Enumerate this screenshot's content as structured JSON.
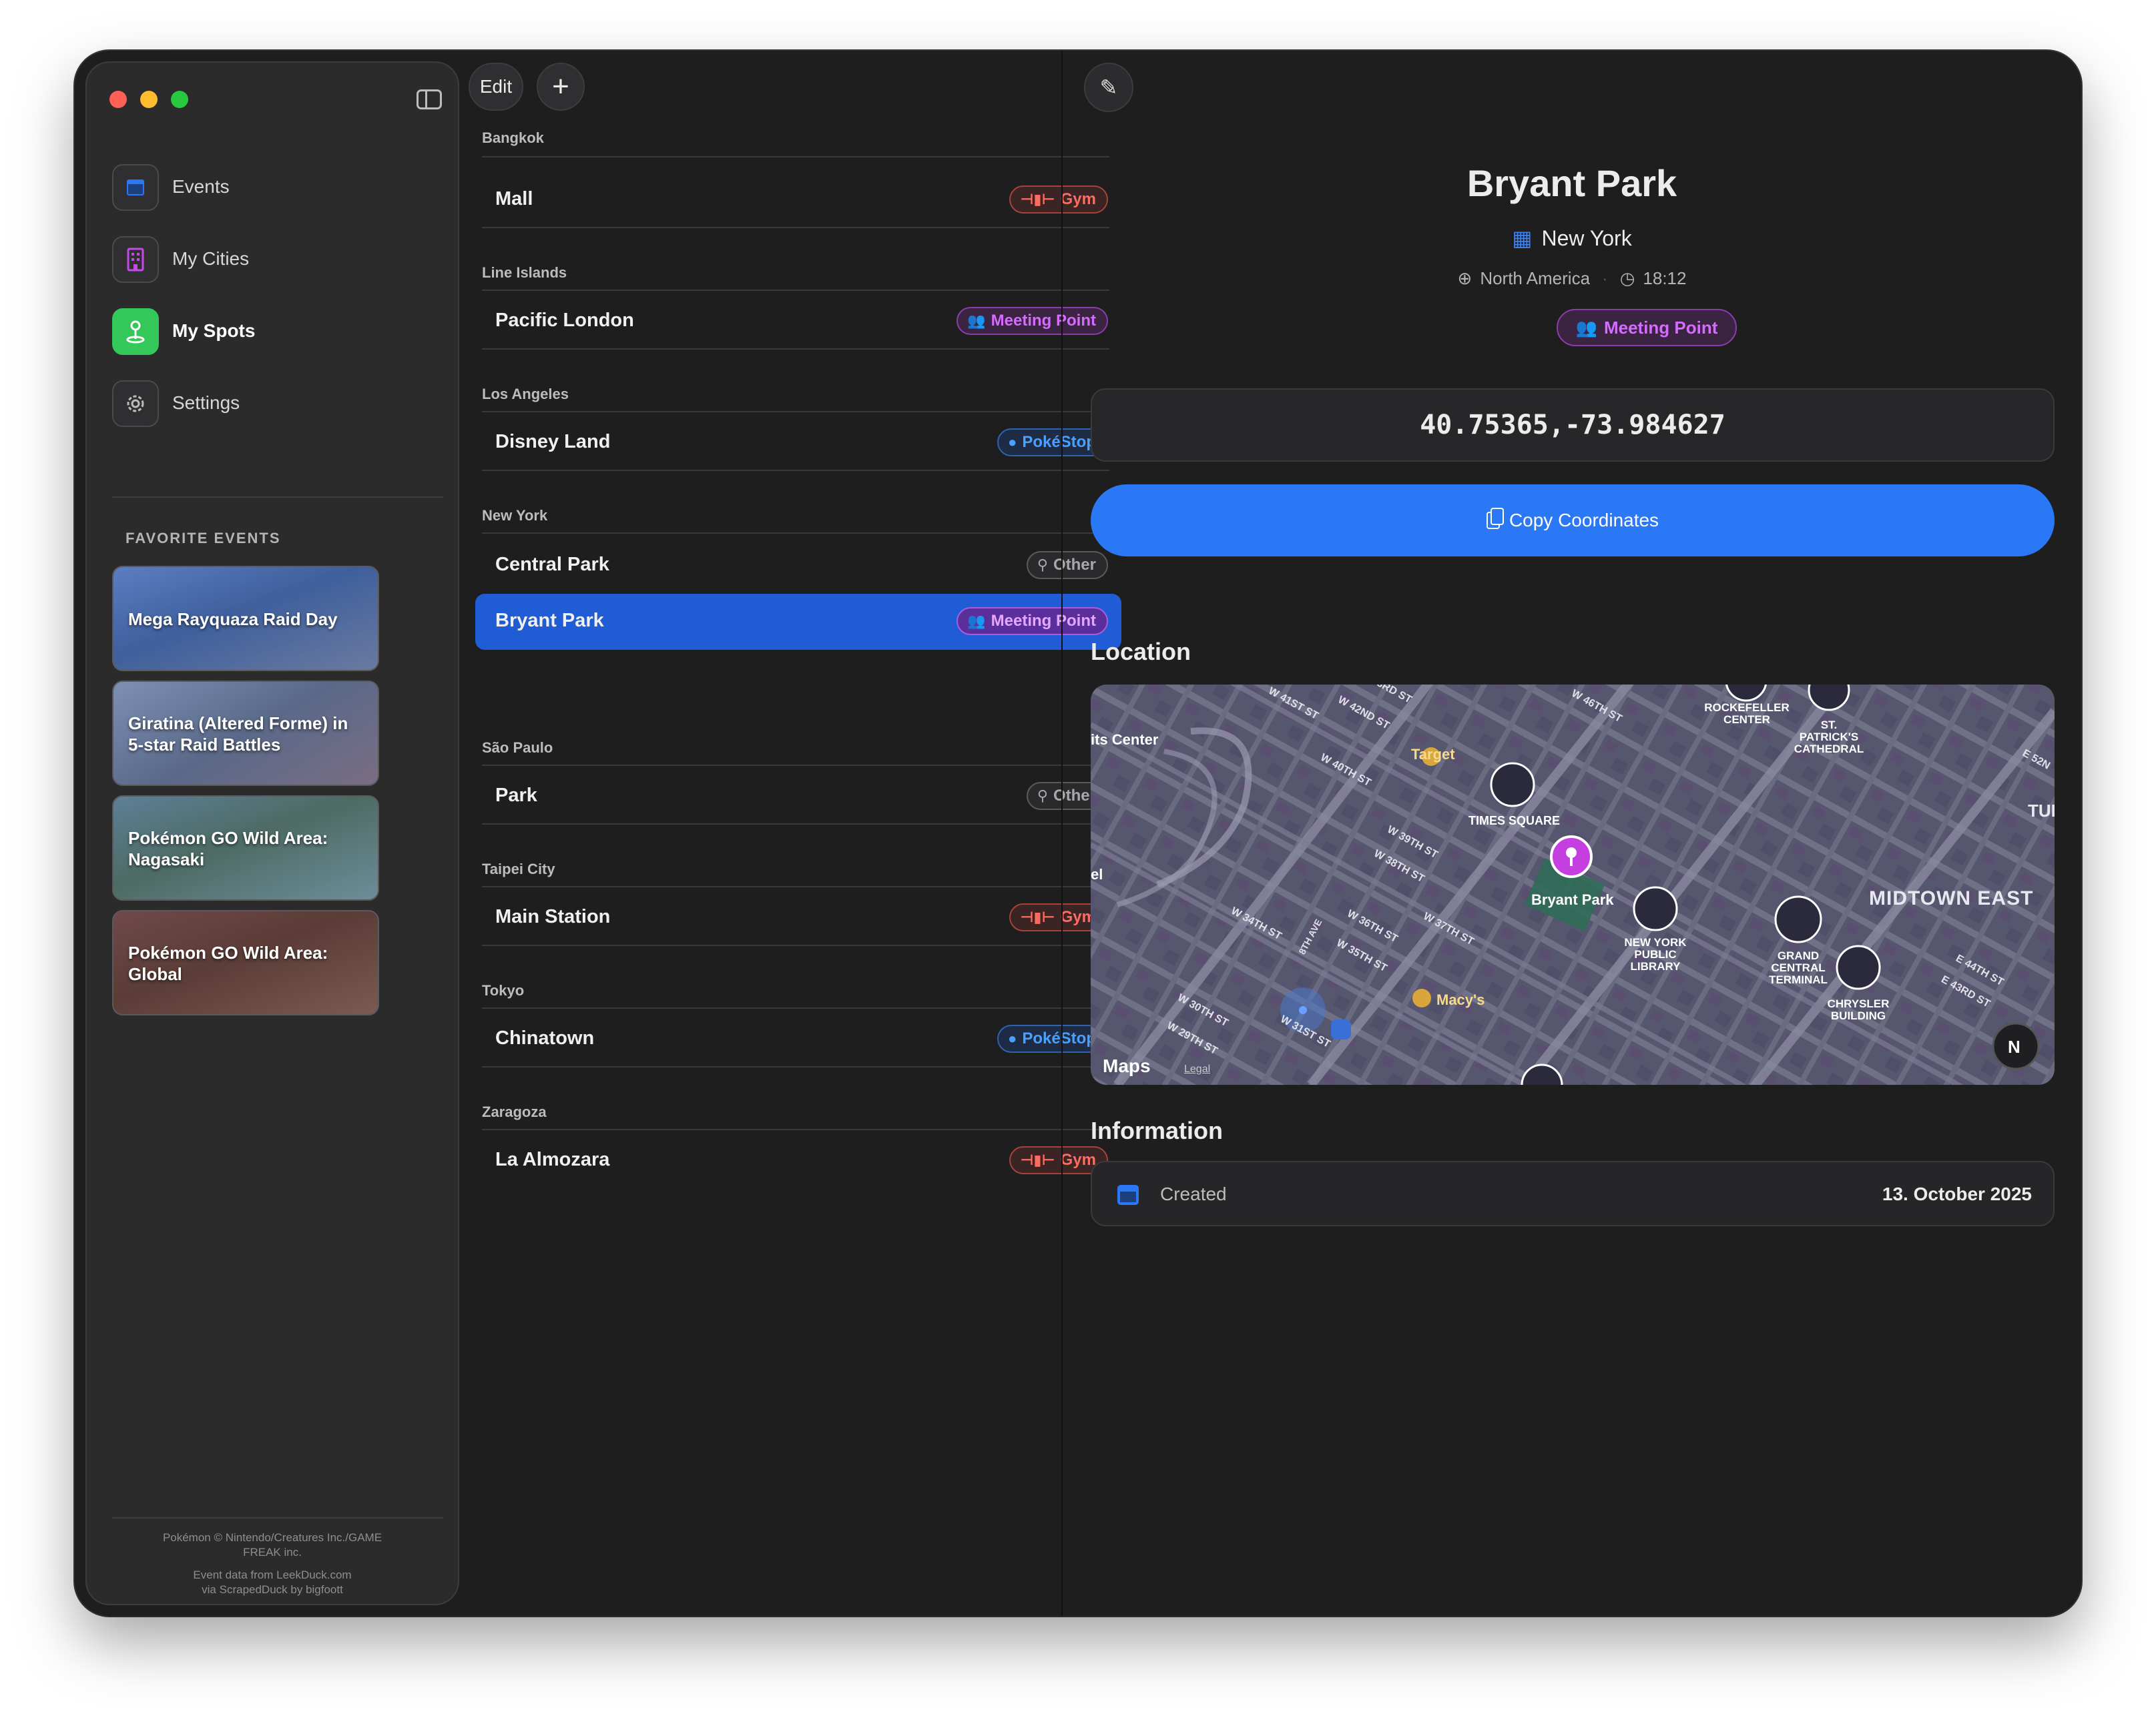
{
  "sidebar": {
    "nav": [
      {
        "label": "Events",
        "icon": "calendar-icon"
      },
      {
        "label": "My Cities",
        "icon": "building-icon"
      },
      {
        "label": "My Spots",
        "icon": "pin-icon"
      },
      {
        "label": "Settings",
        "icon": "gear-icon"
      }
    ],
    "favorites_heading": "FAVORITE EVENTS",
    "favorites": [
      {
        "title": "Mega Rayquaza Raid Day"
      },
      {
        "title": "Giratina (Altered Forme) in 5-star Raid Battles"
      },
      {
        "title": "Pokémon GO Wild Area: Nagasaki"
      },
      {
        "title": "Pokémon GO Wild Area: Global"
      }
    ],
    "credits": {
      "line1": "Pokémon © Nintendo/Creatures Inc./GAME",
      "line2": "FREAK inc.",
      "line3": "Event data from LeekDuck.com",
      "line4": "via ScrapedDuck by bigfoott"
    }
  },
  "toolbar": {
    "edit_label": "Edit",
    "add_label": "+"
  },
  "spots": {
    "sections": [
      {
        "city": "Bangkok",
        "items": [
          {
            "name": "Mall",
            "tag": "Gym"
          }
        ]
      },
      {
        "city": "Line Islands",
        "items": [
          {
            "name": "Pacific London",
            "tag": "Meeting Point"
          }
        ]
      },
      {
        "city": "Los Angeles",
        "items": [
          {
            "name": "Disney Land",
            "tag": "PokéStop"
          }
        ]
      },
      {
        "city": "New York",
        "items": [
          {
            "name": "Central Park",
            "tag": "Other"
          },
          {
            "name": "Bryant Park",
            "tag": "Meeting Point"
          }
        ]
      },
      {
        "city": "São Paulo",
        "items": [
          {
            "name": "Park",
            "tag": "Other"
          }
        ]
      },
      {
        "city": "Taipei City",
        "items": [
          {
            "name": "Main Station",
            "tag": "Gym"
          }
        ]
      },
      {
        "city": "Tokyo",
        "items": [
          {
            "name": "Chinatown",
            "tag": "PokéStop"
          }
        ]
      },
      {
        "city": "Zaragoza",
        "items": [
          {
            "name": "La Almozara",
            "tag": "Gym"
          }
        ]
      }
    ]
  },
  "detail": {
    "title": "Bryant Park",
    "city": "New York",
    "region": "North America",
    "time": "18:12",
    "tag": "Meeting Point",
    "coordinates": "40.75365,-73.984627",
    "copy_label": "Copy Coordinates",
    "location_heading": "Location",
    "information_heading": "Information",
    "info": {
      "label": "Created",
      "value": "13. October 2025"
    }
  },
  "map": {
    "labels": {
      "target": "Target",
      "times_square": "TIMES SQUARE",
      "bryant_park": "Bryant Park",
      "nypl": [
        "NEW YORK",
        "PUBLIC",
        "LIBRARY"
      ],
      "gct": [
        "GRAND",
        "CENTRAL",
        "TERMINAL"
      ],
      "chrysler": [
        "CHRYSLER",
        "BUILDING"
      ],
      "rockefeller": [
        "ROCKEFELLER",
        "CENTER"
      ],
      "stpatricks": [
        "ST.",
        "PATRICK'S",
        "CATHEDRAL"
      ],
      "midtown_east": "MIDTOWN EAST",
      "macys": "Macy's",
      "arts_center": "its Center",
      "tur": "TUR",
      "el": "el",
      "compass": "N",
      "brand": "Maps",
      "legal": "Legal"
    },
    "streets": [
      "W 41ST ST",
      "W 42ND ST",
      "3RD ST",
      "W 46TH ST",
      "W 40TH ST",
      "W 39TH ST",
      "W 38TH ST",
      "W 37TH ST",
      "W 36TH ST",
      "W 35TH ST",
      "W 34TH ST",
      "8TH AVE",
      "W 30TH ST",
      "W 29TH ST",
      "W 31ST ST",
      "E 44TH ST",
      "E 43RD ST",
      "E 52N"
    ]
  },
  "colors": {
    "accent": "#2b78f6",
    "selection": "#1f5cd6",
    "gym": "#ff6b60",
    "meeting": "#d66bff",
    "pokestop": "#4aa0ff",
    "other": "#a8a8aa",
    "my_spots": "#34c759"
  }
}
